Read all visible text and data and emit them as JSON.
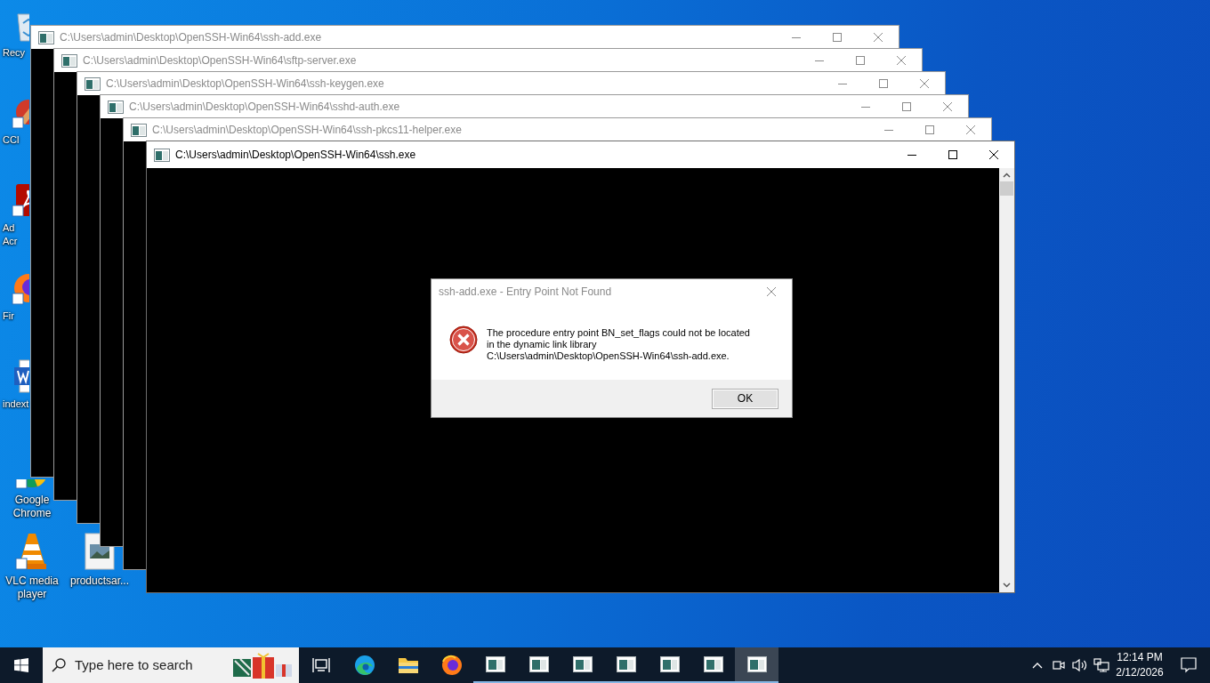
{
  "desktop_icons": [
    {
      "kind": "recycle",
      "label": "Recy",
      "cut": true
    },
    {
      "kind": "ccleaner",
      "label": "CCl",
      "cut": true
    },
    {
      "kind": "acrobat",
      "label": "Ad\nAcr",
      "cut": true
    },
    {
      "kind": "firefox",
      "label": "Fir",
      "cut": true
    },
    {
      "kind": "word",
      "label": "indext",
      "cut": true
    },
    {
      "kind": "chrome",
      "label": "Google\nChrome",
      "cut": false
    },
    {
      "kind": "vlc",
      "label": "VLC media\nplayer",
      "cut": false
    },
    {
      "kind": "image",
      "label": "productsar...",
      "cut": false
    }
  ],
  "windows": [
    {
      "title": "C:\\Users\\admin\\Desktop\\OpenSSH-Win64\\ssh-add.exe",
      "active": false
    },
    {
      "title": "C:\\Users\\admin\\Desktop\\OpenSSH-Win64\\sftp-server.exe",
      "active": false
    },
    {
      "title": "C:\\Users\\admin\\Desktop\\OpenSSH-Win64\\ssh-keygen.exe",
      "active": false
    },
    {
      "title": "C:\\Users\\admin\\Desktop\\OpenSSH-Win64\\sshd-auth.exe",
      "active": false
    },
    {
      "title": "C:\\Users\\admin\\Desktop\\OpenSSH-Win64\\ssh-pkcs11-helper.exe",
      "active": false
    },
    {
      "title": "C:\\Users\\admin\\Desktop\\OpenSSH-Win64\\ssh.exe",
      "active": true
    }
  ],
  "dialog": {
    "title": "ssh-add.exe - Entry Point Not Found",
    "message_lines": [
      "The procedure entry point BN_set_flags could not be located",
      "in the dynamic link library",
      "C:\\Users\\admin\\Desktop\\OpenSSH-Win64\\ssh-add.exe."
    ],
    "button": "OK"
  },
  "taskbar": {
    "search": {
      "placeholder": "Type here to search"
    },
    "apps": [
      {
        "kind": "taskview",
        "running": false,
        "active": false
      },
      {
        "kind": "edge",
        "running": false,
        "active": false
      },
      {
        "kind": "explorer",
        "running": false,
        "active": false
      },
      {
        "kind": "firefox",
        "running": false,
        "active": false
      },
      {
        "kind": "console",
        "running": true,
        "active": false
      },
      {
        "kind": "console",
        "running": true,
        "active": false
      },
      {
        "kind": "console",
        "running": true,
        "active": false
      },
      {
        "kind": "console",
        "running": true,
        "active": false
      },
      {
        "kind": "console",
        "running": true,
        "active": false
      },
      {
        "kind": "console",
        "running": true,
        "active": false
      },
      {
        "kind": "console",
        "running": true,
        "active": true
      }
    ],
    "clock": {
      "time": "12:14 PM",
      "date": "2/12/2026"
    }
  }
}
